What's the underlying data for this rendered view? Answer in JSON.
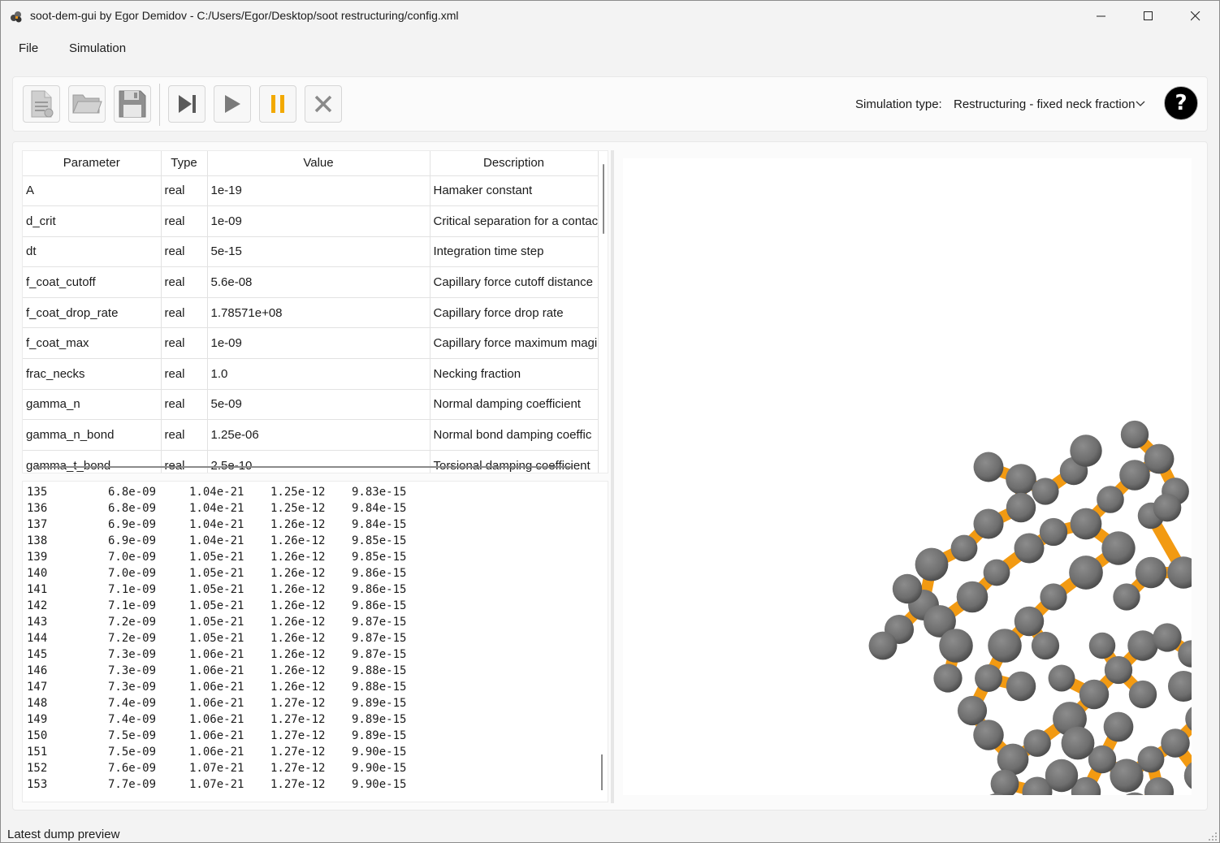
{
  "window": {
    "title": "soot-dem-gui by Egor Demidov - C:/Users/Egor/Desktop/soot restructuring/config.xml",
    "minimize_label": "minimize",
    "maximize_label": "maximize",
    "close_label": "close"
  },
  "menu": {
    "file": "File",
    "simulation": "Simulation"
  },
  "toolbar": {
    "simulation_type_label": "Simulation type:",
    "simulation_type_value": "Restructuring - fixed neck fraction",
    "help_label": "?",
    "buttons": [
      {
        "name": "new-file",
        "icon": "new-document-icon"
      },
      {
        "name": "open-file",
        "icon": "folder-open-icon"
      },
      {
        "name": "save-file",
        "icon": "floppy-disk-icon"
      },
      {
        "name": "step",
        "icon": "skip-forward-icon"
      },
      {
        "name": "run",
        "icon": "play-icon"
      },
      {
        "name": "pause",
        "icon": "pause-icon"
      },
      {
        "name": "stop",
        "icon": "x-icon"
      }
    ]
  },
  "params": {
    "headers": [
      "Parameter",
      "Type",
      "Value",
      "Description"
    ],
    "rows": [
      [
        "A",
        "real",
        "1e-19",
        "Hamaker constant"
      ],
      [
        "d_crit",
        "real",
        "1e-09",
        "Critical separation for a contac"
      ],
      [
        "dt",
        "real",
        "5e-15",
        "Integration time step"
      ],
      [
        "f_coat_cutoff",
        "real",
        "5.6e-08",
        "Capillary force cutoff distance"
      ],
      [
        "f_coat_drop_rate",
        "real",
        "1.78571e+08",
        "Capillary force drop rate"
      ],
      [
        "f_coat_max",
        "real",
        "1e-09",
        "Capillary force maximum magi"
      ],
      [
        "frac_necks",
        "real",
        "1.0",
        "Necking fraction"
      ],
      [
        "gamma_n",
        "real",
        "5e-09",
        "Normal damping coefficient"
      ],
      [
        "gamma_n_bond",
        "real",
        "1.25e-06",
        "Normal bond damping coeffic"
      ],
      [
        "gamma_t_bond",
        "real",
        "2.5e-10",
        "Torsional damping coefficient"
      ]
    ]
  },
  "log": {
    "rows": [
      [
        "135",
        "6.8e-09",
        "1.04e-21",
        "1.25e-12",
        "9.83e-15"
      ],
      [
        "136",
        "6.8e-09",
        "1.04e-21",
        "1.25e-12",
        "9.84e-15"
      ],
      [
        "137",
        "6.9e-09",
        "1.04e-21",
        "1.26e-12",
        "9.84e-15"
      ],
      [
        "138",
        "6.9e-09",
        "1.04e-21",
        "1.26e-12",
        "9.85e-15"
      ],
      [
        "139",
        "7.0e-09",
        "1.05e-21",
        "1.26e-12",
        "9.85e-15"
      ],
      [
        "140",
        "7.0e-09",
        "1.05e-21",
        "1.26e-12",
        "9.86e-15"
      ],
      [
        "141",
        "7.1e-09",
        "1.05e-21",
        "1.26e-12",
        "9.86e-15"
      ],
      [
        "142",
        "7.1e-09",
        "1.05e-21",
        "1.26e-12",
        "9.86e-15"
      ],
      [
        "143",
        "7.2e-09",
        "1.05e-21",
        "1.26e-12",
        "9.87e-15"
      ],
      [
        "144",
        "7.2e-09",
        "1.05e-21",
        "1.26e-12",
        "9.87e-15"
      ],
      [
        "145",
        "7.3e-09",
        "1.06e-21",
        "1.26e-12",
        "9.87e-15"
      ],
      [
        "146",
        "7.3e-09",
        "1.06e-21",
        "1.26e-12",
        "9.88e-15"
      ],
      [
        "147",
        "7.3e-09",
        "1.06e-21",
        "1.26e-12",
        "9.88e-15"
      ],
      [
        "148",
        "7.4e-09",
        "1.06e-21",
        "1.27e-12",
        "9.89e-15"
      ],
      [
        "149",
        "7.4e-09",
        "1.06e-21",
        "1.27e-12",
        "9.89e-15"
      ],
      [
        "150",
        "7.5e-09",
        "1.06e-21",
        "1.27e-12",
        "9.89e-15"
      ],
      [
        "151",
        "7.5e-09",
        "1.06e-21",
        "1.27e-12",
        "9.90e-15"
      ],
      [
        "152",
        "7.6e-09",
        "1.07e-21",
        "1.27e-12",
        "9.90e-15"
      ],
      [
        "153",
        "7.7e-09",
        "1.07e-21",
        "1.27e-12",
        "9.90e-15"
      ]
    ]
  },
  "viewer": {
    "particle_color": "#6e6e6e",
    "neck_color": "#f29a12"
  },
  "status": {
    "text": "Latest dump preview"
  },
  "colors": {
    "accent_pause": "#f2a900",
    "help_bg": "#000000"
  }
}
